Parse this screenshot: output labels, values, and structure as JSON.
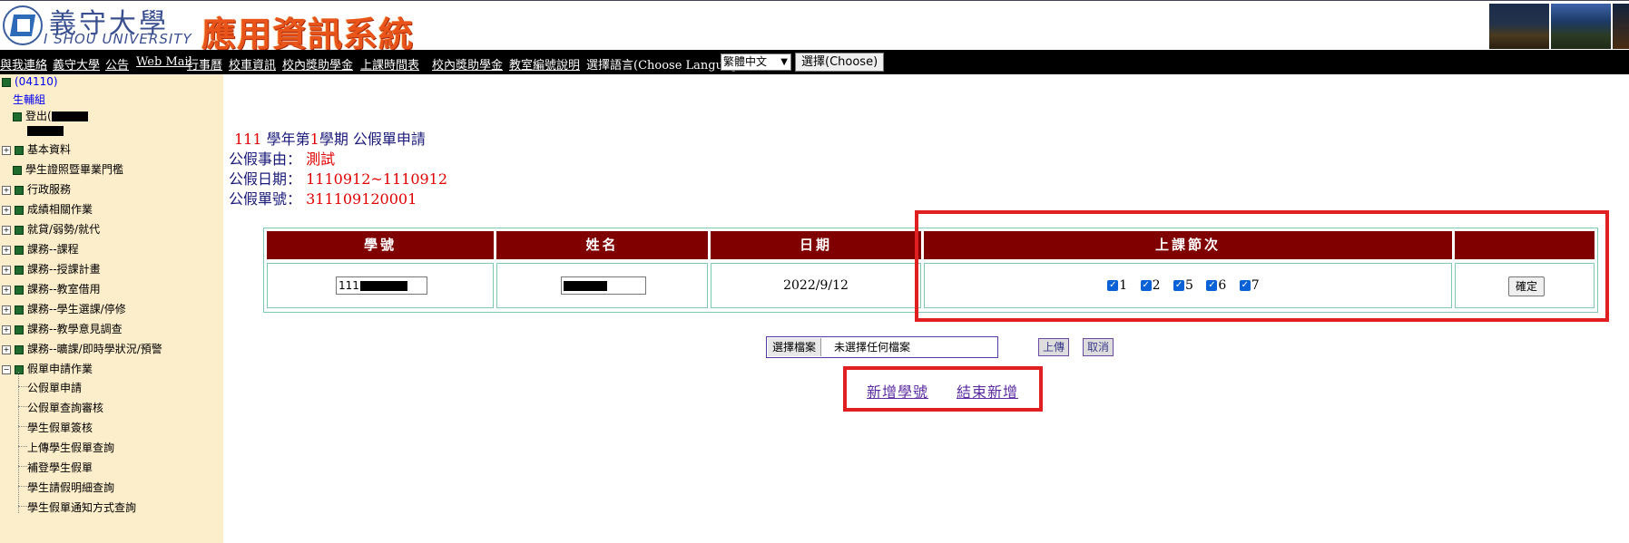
{
  "header": {
    "univ_name": "義守大學",
    "univ_en": "I SHOU UNIVERSITY",
    "system_title": "應用資訊系統"
  },
  "nav": {
    "links": [
      "與我連絡",
      "義守大學",
      "公告",
      "Web Mail",
      "行事曆",
      "校車資訊",
      "校內獎助學金",
      "上課時間表",
      "校內獎助學金",
      "教室編號說明"
    ],
    "language_label": "選擇語言(Choose Language):",
    "language_selected": "繁體中文",
    "choose_button": "選擇(Choose)"
  },
  "sidebar": {
    "user_code": "(04110)",
    "dept": "生輔組",
    "logout": "登出(",
    "items": [
      "基本資料",
      "學生證照暨畢業門檻",
      "行政服務",
      "成績相關作業",
      "就貸/弱勢/就代",
      "課務--課程",
      "課務--授課計畫",
      "課務--教室借用",
      "課務--學生選課/停修",
      "課務--教學意見調查",
      "課務--曠課/即時學狀況/預警",
      "假單申請作業"
    ],
    "subitems": [
      "公假單申請",
      "公假單查詢審核",
      "學生假單簽核",
      "上傳學生假單查詢",
      "補登學生假單",
      "學生請假明細查詢",
      "學生假單通知方式查詢"
    ]
  },
  "form": {
    "year": "111",
    "title_mid": "學年第",
    "semester": "1",
    "title_end": "學期 公假單申請",
    "reason_label": "公假事由：",
    "reason_value": "測試",
    "date_label": "公假日期：",
    "date_value": "1110912~1110912",
    "number_label": "公假單號：",
    "number_value": "311109120001"
  },
  "table": {
    "headers": [
      "學號",
      "姓名",
      "日期",
      "上課節次",
      ""
    ],
    "row": {
      "student_id": "111",
      "name": "",
      "date": "2022/9/12",
      "periods": [
        "1",
        "2",
        "5",
        "6",
        "7"
      ],
      "confirm": "確定"
    }
  },
  "upload": {
    "file_button": "選擇檔案",
    "file_status": "未選擇任何檔案",
    "upload_button": "上傳",
    "cancel_button": "取消"
  },
  "actions": {
    "add_student": "新增學號",
    "end_add": "結束新增"
  },
  "colors": {
    "header_bg": "#800000",
    "sidebar_bg": "#fcedcb",
    "highlight": "#e02020"
  }
}
